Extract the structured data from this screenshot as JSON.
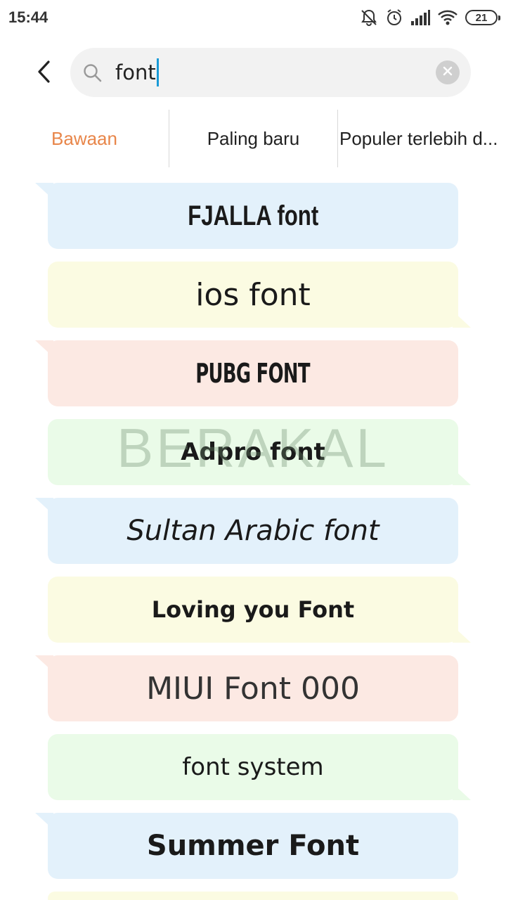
{
  "status_bar": {
    "time": "15:44",
    "icons": [
      "bell-off-icon",
      "alarm-icon",
      "signal-icon",
      "wifi-icon"
    ],
    "battery_level": "21"
  },
  "search": {
    "value": "font",
    "placeholder": ""
  },
  "tabs": [
    {
      "label": "Bawaan",
      "active": true
    },
    {
      "label": "Paling baru",
      "active": false
    },
    {
      "label": "Populer terlebih d...",
      "active": false
    }
  ],
  "fonts": [
    {
      "name": "FJALLA font",
      "color": "#e3f1fb"
    },
    {
      "name": "ios font",
      "color": "#fbfbe2"
    },
    {
      "name": "PUBG FONT",
      "color": "#fce9e3"
    },
    {
      "name": "Adpro font",
      "color": "#eafbe8"
    },
    {
      "name": "Sultan Arabic font",
      "color": "#e3f1fb"
    },
    {
      "name": "Loving you Font",
      "color": "#fbfbe2"
    },
    {
      "name": "MIUI Font 000",
      "color": "#fce9e3"
    },
    {
      "name": "font system",
      "color": "#eafbe8"
    },
    {
      "name": "Summer Font",
      "color": "#e3f1fb"
    }
  ],
  "watermark": "BERAKAL",
  "colors": {
    "active_tab": "#e8864a",
    "caret": "#1a9bd7"
  }
}
